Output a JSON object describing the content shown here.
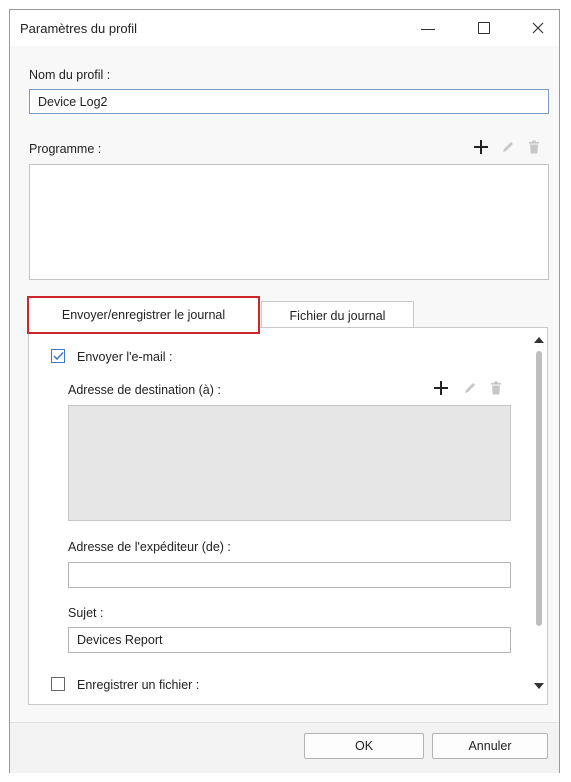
{
  "window": {
    "title": "Paramètres du profil",
    "controls": {
      "minimize": "—",
      "maximize": "☐",
      "close": "✕"
    }
  },
  "profile_name": {
    "label": "Nom du profil :",
    "value": "Device Log2"
  },
  "schedule": {
    "label": "Programme :",
    "icons": [
      "add-icon",
      "edit-icon",
      "delete-icon"
    ]
  },
  "tabs": [
    {
      "label": "Envoyer/enregistrer le journal",
      "active": true
    },
    {
      "label": "Fichier du journal",
      "active": false
    }
  ],
  "send_email": {
    "label": "Envoyer l'e-mail :",
    "checked": true,
    "destination_label": "Adresse de destination (à) :",
    "sender_label": "Adresse de l'expéditeur (de) :",
    "sender_value": "",
    "subject_label": "Sujet :",
    "subject_value": "Devices Report"
  },
  "save_file": {
    "label": "Enregistrer un fichier :",
    "checked": false
  },
  "buttons": {
    "ok": "OK",
    "cancel": "Annuler"
  },
  "colors": {
    "tab_highlight": "#d0262b",
    "checkbox_accent": "#3b78c5"
  }
}
